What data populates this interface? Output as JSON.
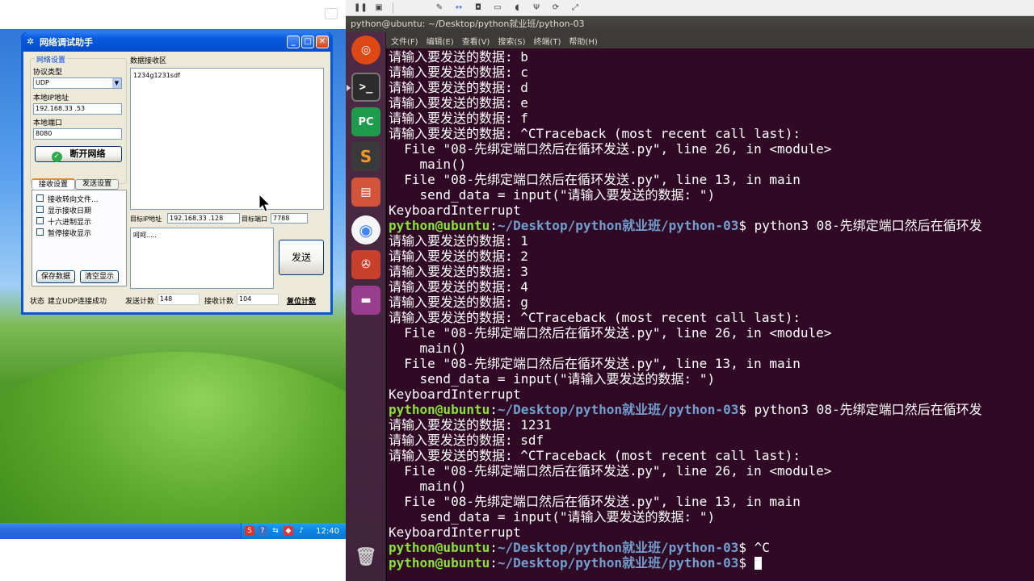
{
  "xp": {
    "window_title": "网络调试助手",
    "group_network": "网络设置",
    "protocol_label": "协议类型",
    "protocol_value": "UDP",
    "local_ip_label": "本地IP地址",
    "local_ip_value": "192.168.33 .53",
    "local_port_label": "本地端口",
    "local_port_value": "8080",
    "disconnect_label": "断开网络",
    "recv_area_label": "数据接收区",
    "recv_content": "1234g1231sdf",
    "tab_recv": "接收设置",
    "tab_send": "发送设置",
    "options": [
      "接收转向文件...",
      "显示接收日期",
      "十六进制显示",
      "暂停接收显示"
    ],
    "save_data": "保存数据",
    "clear_display": "清空显示",
    "target_ip_label": "目标IP地址",
    "target_ip_value": "192.168.33 .128",
    "target_port_label": "目标端口",
    "target_port_value": "7788",
    "send_text": "呵呵.....",
    "send_button": "发送",
    "status_label": "状态",
    "status_text": "建立UDP连接成功",
    "send_count_label": "发送计数",
    "send_count": "148",
    "recv_count_label": "接收计数",
    "recv_count": "104",
    "reset_count": "复位计数",
    "clock": "12:40"
  },
  "ubuntu": {
    "window_title": "python@ubuntu: ~/Desktop/python就业班/python-03",
    "menu": [
      "文件(F)",
      "编辑(E)",
      "查看(V)",
      "搜索(S)",
      "终端(T)",
      "帮助(H)"
    ]
  },
  "terminal": {
    "user": "python@ubuntu",
    "path": "~/Desktop/python就业班/python-03",
    "lines": [
      {
        "text": "请输入要发送的数据: b"
      },
      {
        "text": "请输入要发送的数据: c"
      },
      {
        "text": "请输入要发送的数据: d"
      },
      {
        "text": "请输入要发送的数据: e"
      },
      {
        "text": "请输入要发送的数据: f"
      },
      {
        "text": "请输入要发送的数据: ^CTraceback (most recent call last):"
      },
      {
        "text": "  File \"08-先绑定端口然后在循环发送.py\", line 26, in <module>"
      },
      {
        "text": "    main()"
      },
      {
        "text": "  File \"08-先绑定端口然后在循环发送.py\", line 13, in main"
      },
      {
        "text": "    send_data = input(\"请输入要发送的数据: \")"
      },
      {
        "text": "KeyboardInterrupt"
      },
      {
        "prompt": true,
        "text": " python3 08-先绑定端口然后在循环发"
      },
      {
        "text": "请输入要发送的数据: 1"
      },
      {
        "text": "请输入要发送的数据: 2"
      },
      {
        "text": "请输入要发送的数据: 3"
      },
      {
        "text": "请输入要发送的数据: 4"
      },
      {
        "text": "请输入要发送的数据: g"
      },
      {
        "text": "请输入要发送的数据: ^CTraceback (most recent call last):"
      },
      {
        "text": "  File \"08-先绑定端口然后在循环发送.py\", line 26, in <module>"
      },
      {
        "text": "    main()"
      },
      {
        "text": "  File \"08-先绑定端口然后在循环发送.py\", line 13, in main"
      },
      {
        "text": "    send_data = input(\"请输入要发送的数据: \")"
      },
      {
        "text": "KeyboardInterrupt"
      },
      {
        "prompt": true,
        "text": " python3 08-先绑定端口然后在循环发"
      },
      {
        "text": "请输入要发送的数据: 1231"
      },
      {
        "text": "请输入要发送的数据: sdf"
      },
      {
        "text": "请输入要发送的数据: ^CTraceback (most recent call last):"
      },
      {
        "text": "  File \"08-先绑定端口然后在循环发送.py\", line 26, in <module>"
      },
      {
        "text": "    main()"
      },
      {
        "text": "  File \"08-先绑定端口然后在循环发送.py\", line 13, in main"
      },
      {
        "text": "    send_data = input(\"请输入要发送的数据: \")"
      },
      {
        "text": "KeyboardInterrupt"
      },
      {
        "prompt": true,
        "text": " ^C"
      },
      {
        "prompt": true,
        "text": " ",
        "cursor": true
      }
    ]
  },
  "colors": {
    "terminal_bg": "#300a24",
    "prompt_user": "#8ae234",
    "prompt_path": "#729fcf",
    "launcher_bg": "#4d2a46"
  }
}
